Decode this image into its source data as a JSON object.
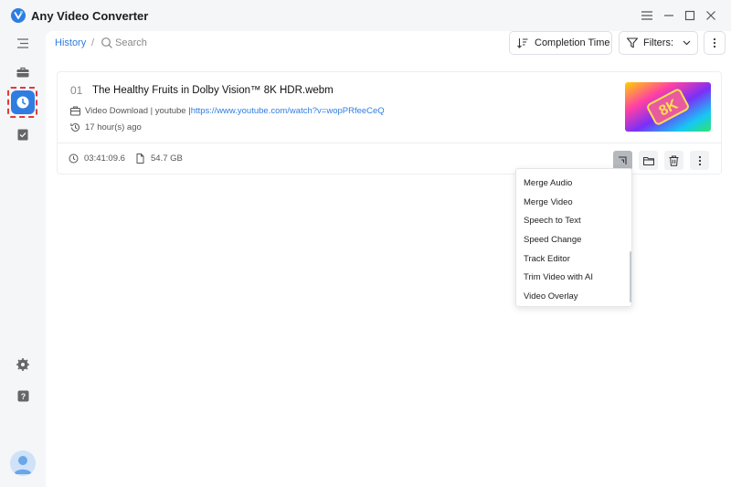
{
  "app": {
    "title": "Any Video Converter"
  },
  "header": {
    "breadcrumb_history": "History",
    "breadcrumb_sep": "/",
    "search_placeholder": "Search",
    "sort_label": "Completion Time",
    "filters_label": "Filters:"
  },
  "sidebar": {
    "items": [
      {
        "name": "menu-icon"
      },
      {
        "name": "toolbox-icon"
      },
      {
        "name": "history-icon",
        "active": true
      },
      {
        "name": "bookmark-icon"
      },
      {
        "name": "settings-icon"
      },
      {
        "name": "help-icon"
      }
    ]
  },
  "card": {
    "index": "01",
    "title": "The Healthy Fruits in Dolby Vision™  8K HDR.webm",
    "source_prefix": "Video Download | youtube | ",
    "source_link": "https://www.youtube.com/watch?v=wopPRfeeCeQ",
    "time_ago": "17 hour(s) ago",
    "duration": "03:41:09.6",
    "size": "54.7 GB"
  },
  "dropdown": {
    "items": [
      "Merge Audio",
      "Merge Video",
      "Speech to Text",
      "Speed Change",
      "Track Editor",
      "Trim Video with AI",
      "Video Overlay"
    ]
  },
  "colors": {
    "accent": "#2f7de1",
    "highlight": "#e53935"
  }
}
